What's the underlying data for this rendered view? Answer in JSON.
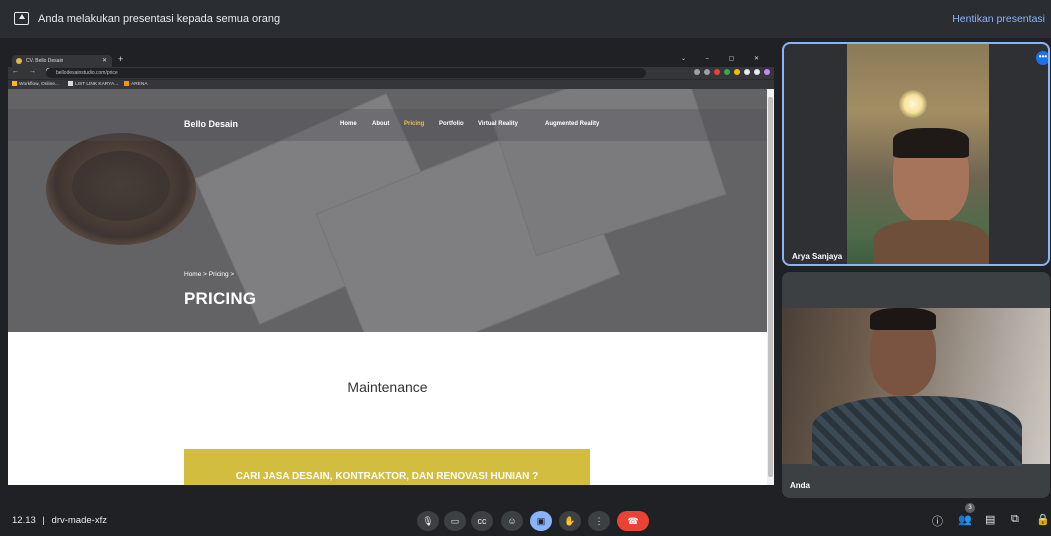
{
  "presentation_bar": {
    "message": "Anda melakukan presentasi kepada semua orang",
    "stop_label": "Hentikan presentasi"
  },
  "browser": {
    "tab_title": "CV. Bello Desain",
    "url": "bellodesainstudio.com/price",
    "bookmarks": [
      "Workflow, Onlinе...",
      "LIST LINK KARYA...",
      "ARENA"
    ]
  },
  "website": {
    "brand": "Bello Desain",
    "nav": [
      "Home",
      "About",
      "Pricing",
      "Portfolio",
      "Virtual Reality",
      "Augmented Reality"
    ],
    "active_nav": "Pricing",
    "breadcrumb": "Home >  Pricing >",
    "heading": "PRICING",
    "section_title": "Maintenance",
    "cta_text": "CARI JASA DESAIN, KONTRAKTOR, DAN RENOVASI HUNIAN ?"
  },
  "participants": [
    {
      "name": "Arya Sanjaya",
      "menu_icon": "more-options-icon"
    },
    {
      "name": "Anda"
    }
  ],
  "bottom_bar": {
    "time": "12.13",
    "separator": "|",
    "meeting_code": "drv-made-xfz",
    "participant_count": "3",
    "controls": [
      "mic-icon",
      "camera-icon",
      "captions-icon",
      "emoji-icon",
      "present-icon",
      "raise-hand-icon",
      "more-options-icon",
      "end-call-icon"
    ],
    "right_icons": [
      "info-icon",
      "people-icon",
      "chat-icon",
      "activities-icon",
      "host-controls-icon"
    ]
  },
  "colors": {
    "accent": "#8ab4f8",
    "end_call": "#ea4335",
    "cta_yellow": "#d3bd3e",
    "active_nav": "#e2c04f"
  }
}
